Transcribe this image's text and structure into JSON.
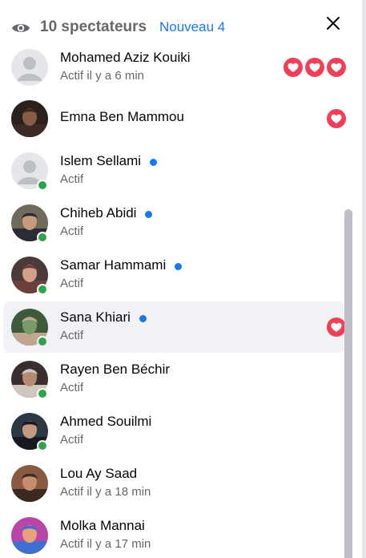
{
  "header": {
    "viewers_label": "10 spectateurs",
    "new_label": "Nouveau 4"
  },
  "colors": {
    "accent": "#1877f2",
    "online": "#31a24c",
    "love": "#f33e58"
  },
  "viewers": [
    {
      "name": "Mohamed Aziz Kouiki",
      "status": "Actif il y a 6 min",
      "online": false,
      "is_new": false,
      "reactions": 3,
      "avatar": "default"
    },
    {
      "name": "Emna Ben Mammou",
      "status": "",
      "online": false,
      "is_new": false,
      "reactions": 1,
      "avatar": "photo-dark-hair"
    },
    {
      "name": "Islem Sellami",
      "status": "Actif",
      "online": true,
      "is_new": true,
      "reactions": 0,
      "avatar": "default"
    },
    {
      "name": "Chiheb Abidi",
      "status": "Actif",
      "online": true,
      "is_new": true,
      "reactions": 0,
      "avatar": "photo-graduation"
    },
    {
      "name": "Samar Hammami",
      "status": "Actif",
      "online": true,
      "is_new": true,
      "reactions": 0,
      "avatar": "photo-selfie"
    },
    {
      "name": "Sana Khiari",
      "status": "Actif",
      "online": true,
      "is_new": true,
      "reactions": 1,
      "avatar": "photo-garden",
      "highlighted": true
    },
    {
      "name": "Rayen Ben Béchir",
      "status": "Actif",
      "online": true,
      "is_new": false,
      "reactions": 0,
      "avatar": "photo-cap"
    },
    {
      "name": "Ahmed Souilmi",
      "status": "Actif",
      "online": true,
      "is_new": false,
      "reactions": 0,
      "avatar": "photo-suit"
    },
    {
      "name": "Lou Ay Saad",
      "status": "Actif il y a 18 min",
      "online": false,
      "is_new": false,
      "reactions": 0,
      "avatar": "photo-closeup"
    },
    {
      "name": "Molka Mannai",
      "status": "Actif il y a 17 min",
      "online": false,
      "is_new": false,
      "reactions": 0,
      "avatar": "photo-colorful"
    }
  ]
}
